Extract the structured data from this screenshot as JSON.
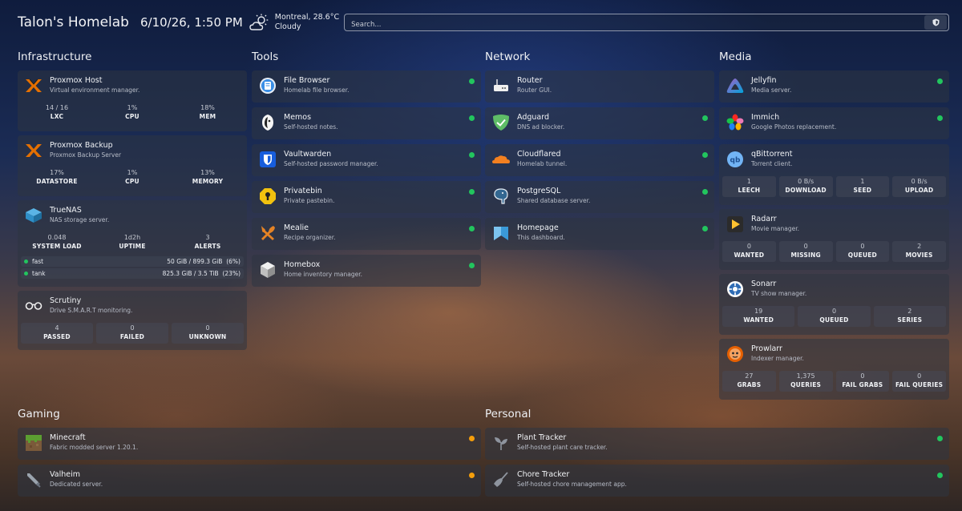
{
  "header": {
    "title": "Talon's Homelab",
    "datetime": "6/10/26, 1:50 PM",
    "weather_location": "Montreal, 28.6°C",
    "weather_condition": "Cloudy",
    "weather_icon": "partly-cloudy-icon",
    "search_placeholder": "Search..."
  },
  "groups": {
    "infrastructure": "Infrastructure",
    "tools": "Tools",
    "network": "Network",
    "media": "Media",
    "gaming": "Gaming",
    "personal": "Personal"
  },
  "infrastructure": {
    "proxmox_host": {
      "name": "Proxmox Host",
      "desc": "Virtual environment manager.",
      "stats": [
        {
          "v": "14 / 16",
          "l": "LXC"
        },
        {
          "v": "1%",
          "l": "CPU"
        },
        {
          "v": "18%",
          "l": "MEM"
        }
      ]
    },
    "proxmox_backup": {
      "name": "Proxmox Backup",
      "desc": "Proxmox Backup Server",
      "stats": [
        {
          "v": "17%",
          "l": "DATASTORE"
        },
        {
          "v": "1%",
          "l": "CPU"
        },
        {
          "v": "13%",
          "l": "MEMORY"
        }
      ]
    },
    "truenas": {
      "name": "TrueNAS",
      "desc": "NAS storage server.",
      "stats": [
        {
          "v": "0.048",
          "l": "SYSTEM LOAD"
        },
        {
          "v": "1d2h",
          "l": "UPTIME"
        },
        {
          "v": "3",
          "l": "ALERTS"
        }
      ],
      "pools": [
        {
          "name": "fast",
          "value": "50 GiB / 899.3 GiB",
          "pct": "(6%)"
        },
        {
          "name": "tank",
          "value": "825.3 GiB / 3.5 TiB",
          "pct": "(23%)"
        }
      ]
    },
    "scrutiny": {
      "name": "Scrutiny",
      "desc": "Drive S.M.A.R.T monitoring.",
      "stats": [
        {
          "v": "4",
          "l": "PASSED"
        },
        {
          "v": "0",
          "l": "FAILED"
        },
        {
          "v": "0",
          "l": "UNKNOWN"
        }
      ]
    }
  },
  "tools": [
    {
      "name": "File Browser",
      "desc": "Homelab file browser."
    },
    {
      "name": "Memos",
      "desc": "Self-hosted notes."
    },
    {
      "name": "Vaultwarden",
      "desc": "Self-hosted password manager."
    },
    {
      "name": "Privatebin",
      "desc": "Private pastebin."
    },
    {
      "name": "Mealie",
      "desc": "Recipe organizer."
    },
    {
      "name": "Homebox",
      "desc": "Home inventory manager."
    }
  ],
  "network": [
    {
      "name": "Router",
      "desc": "Router GUI."
    },
    {
      "name": "Adguard",
      "desc": "DNS ad blocker."
    },
    {
      "name": "Cloudflared",
      "desc": "Homelab tunnel."
    },
    {
      "name": "PostgreSQL",
      "desc": "Shared database server."
    },
    {
      "name": "Homepage",
      "desc": "This dashboard."
    }
  ],
  "media": {
    "jellyfin": {
      "name": "Jellyfin",
      "desc": "Media server."
    },
    "immich": {
      "name": "Immich",
      "desc": "Google Photos replacement."
    },
    "qbittorrent": {
      "name": "qBittorrent",
      "desc": "Torrent client.",
      "stats": [
        {
          "v": "1",
          "l": "LEECH"
        },
        {
          "v": "0 B/s",
          "l": "DOWNLOAD"
        },
        {
          "v": "1",
          "l": "SEED"
        },
        {
          "v": "0 B/s",
          "l": "UPLOAD"
        }
      ]
    },
    "radarr": {
      "name": "Radarr",
      "desc": "Movie manager.",
      "stats": [
        {
          "v": "0",
          "l": "WANTED"
        },
        {
          "v": "0",
          "l": "MISSING"
        },
        {
          "v": "0",
          "l": "QUEUED"
        },
        {
          "v": "2",
          "l": "MOVIES"
        }
      ]
    },
    "sonarr": {
      "name": "Sonarr",
      "desc": "TV show manager.",
      "stats": [
        {
          "v": "19",
          "l": "WANTED"
        },
        {
          "v": "0",
          "l": "QUEUED"
        },
        {
          "v": "2",
          "l": "SERIES"
        }
      ]
    },
    "prowlarr": {
      "name": "Prowlarr",
      "desc": "Indexer manager.",
      "stats": [
        {
          "v": "27",
          "l": "GRABS"
        },
        {
          "v": "1,375",
          "l": "QUERIES"
        },
        {
          "v": "0",
          "l": "FAIL GRABS"
        },
        {
          "v": "0",
          "l": "FAIL QUERIES"
        }
      ]
    }
  },
  "gaming": [
    {
      "name": "Minecraft",
      "desc": "Fabric modded server 1.20.1."
    },
    {
      "name": "Valheim",
      "desc": "Dedicated server."
    }
  ],
  "personal": [
    {
      "name": "Plant Tracker",
      "desc": "Self-hosted plant care tracker."
    },
    {
      "name": "Chore Tracker",
      "desc": "Self-hosted chore management app."
    }
  ],
  "colors": {
    "status_up": "#22c55e",
    "status_warn": "#f59e0b",
    "card_bg": "rgba(46,52,66,0.55)"
  }
}
